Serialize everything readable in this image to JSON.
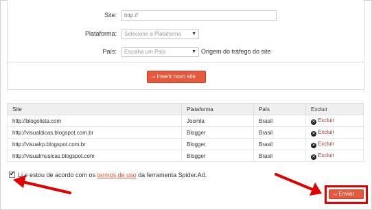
{
  "form": {
    "site_label": "Site:",
    "site_placeholder": "http://",
    "plataforma_label": "Plataforma:",
    "plataforma_value": "Selecione a Plataforma",
    "pais_label": "País:",
    "pais_value": "Escolha um País",
    "origem_text": "Origem do tráfego do site",
    "inserir_icon": "···›",
    "inserir_label": "Inserir novo site"
  },
  "table": {
    "headers": [
      "Site",
      "Plataforma",
      "País",
      "Excluir"
    ],
    "rows": [
      {
        "site": "http://blogolista.com",
        "plataforma": "Joomla",
        "pais": "Brasil",
        "excluir": "Excluir"
      },
      {
        "site": "http://visualdicas.blogspot.com.br",
        "plataforma": "Blogger",
        "pais": "Brasil",
        "excluir": "Excluir"
      },
      {
        "site": "http://visualrp.blogspot.com.br",
        "plataforma": "Blogger",
        "pais": "Brasil",
        "excluir": "Excluir"
      },
      {
        "site": "http://visualmusicas.blogspot.com",
        "plataforma": "Blogger",
        "pais": "Brasil",
        "excluir": "Excluir"
      }
    ]
  },
  "agreement": {
    "checked": true,
    "text_before": "Li e estou de acordo com os ",
    "link_text": "termos de uso",
    "text_after": " da ferramenta Spider.Ad."
  },
  "enviar": {
    "icon": "···›",
    "label": "Enviar"
  },
  "colors": {
    "accent": "#e55a3c",
    "annotation": "#e00000"
  }
}
